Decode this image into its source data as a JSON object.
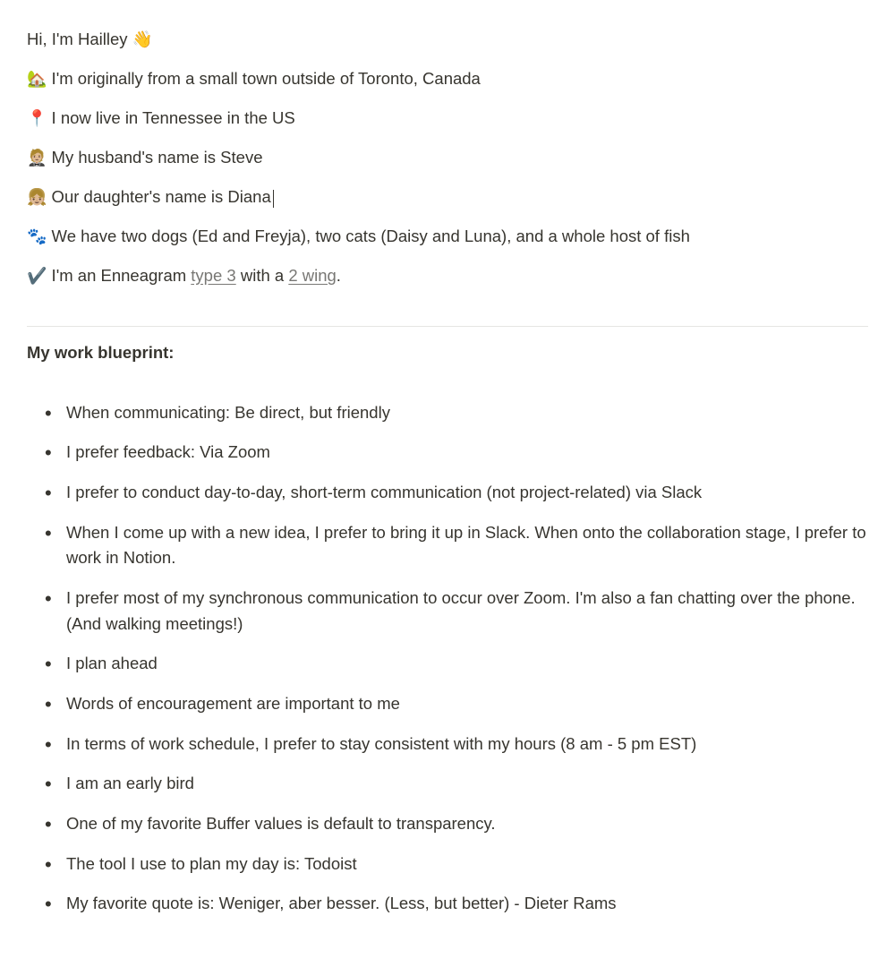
{
  "intro": {
    "line0_text": "Hi, I'm Hailley 👋",
    "line1_emoji": "🏡",
    "line1_text": " I'm originally from a small town outside of Toronto, Canada",
    "line2_emoji": "📍",
    "line2_text": " I now live in Tennessee in the US",
    "line3_emoji": "🤵🏼",
    "line3_text": " My husband's name is Steve",
    "line4_emoji": "👧🏼",
    "line4_text": " Our daughter's name is Diana",
    "line5_emoji": "🐾",
    "line5_text": " We have two dogs (Ed and Freyja), two cats (Daisy and Luna), and a whole host of fish",
    "line6_emoji": "✔️",
    "line6_prefix": " I'm an Enneagram ",
    "line6_link1": "type 3",
    "line6_mid": " with a ",
    "line6_link2": "2 wing",
    "line6_suffix": "."
  },
  "blueprint": {
    "heading": "My work blueprint:",
    "items": [
      "When communicating: Be direct, but friendly",
      "I prefer feedback: Via Zoom",
      "I prefer to conduct day-to-day, short-term communication (not project-related) via Slack",
      "When I come up with a new idea, I prefer to bring it up in Slack. When onto the collaboration stage, I prefer to work in Notion.",
      "I prefer most of my synchronous communication to occur over Zoom. I'm also a fan chatting over the phone. (And walking meetings!)",
      "I plan ahead",
      "Words of encouragement are important to me",
      "In terms of work schedule, I prefer to stay consistent with my hours (8 am - 5 pm EST)",
      "I am an early bird",
      "One of my favorite Buffer values is default to transparency.",
      "The tool I use to plan my day is: Todoist",
      "My favorite quote is: Weniger, aber besser. (Less, but better) - Dieter Rams"
    ]
  }
}
